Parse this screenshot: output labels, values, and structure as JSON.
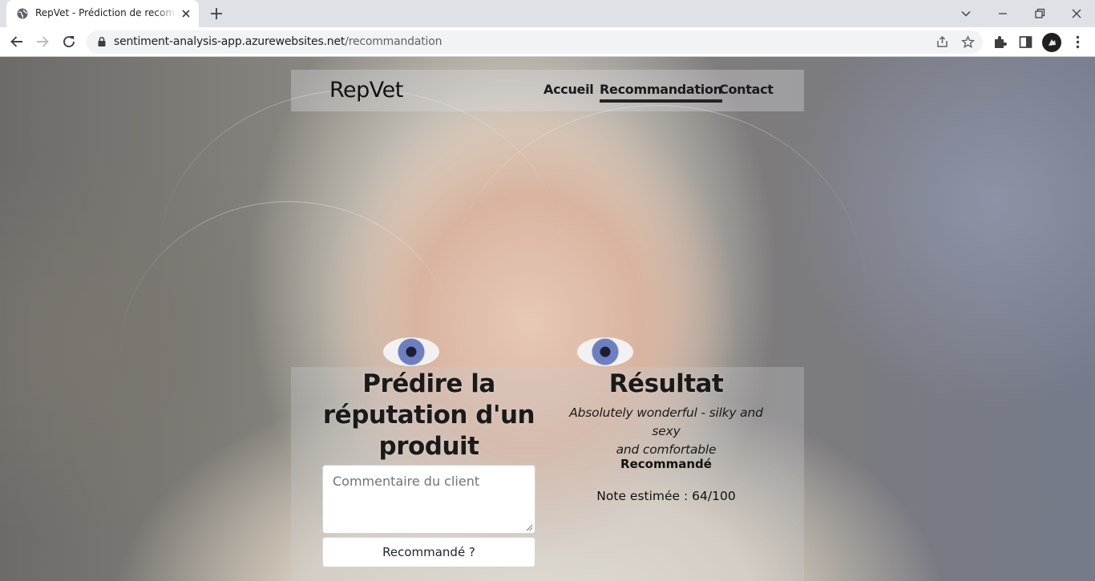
{
  "browser": {
    "tab_title": "RepVet - Prédiction de recommandation",
    "url_host": "sentiment-analysis-app.azurewebsites.net",
    "url_path": "/recommandation"
  },
  "site": {
    "brand": "RepVet",
    "nav": [
      {
        "label": "Accueil"
      },
      {
        "label": "Recommandation",
        "active": true
      },
      {
        "label": "Contact"
      }
    ]
  },
  "form": {
    "title_line1": "Prédire la",
    "title_line2": "réputation d'un",
    "title_line3": "produit",
    "comment_placeholder": "Commentaire du client",
    "comment_value": "",
    "submit_label": "Recommandé ?"
  },
  "result": {
    "title": "Résultat",
    "review_line1": "Absolutely wonderful - silky and sexy",
    "review_line2": "and comfortable",
    "verdict": "Recommandé",
    "score_text": "Note estimée : 64/100"
  }
}
